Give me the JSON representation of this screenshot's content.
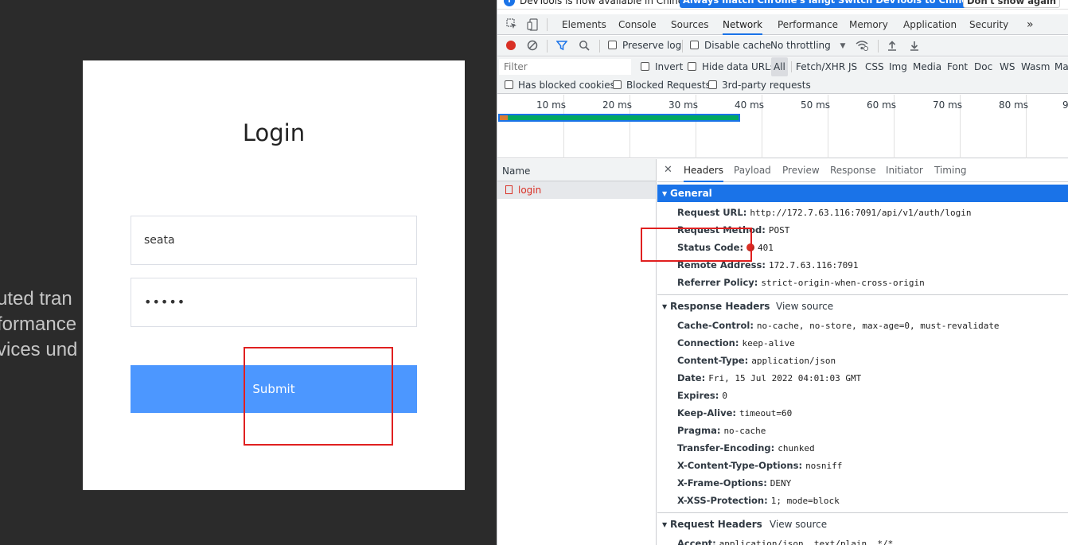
{
  "login_page": {
    "background_lines": [
      "uted tran",
      "formance",
      "vices und"
    ],
    "title": "Login",
    "username_value": "seata",
    "password_value": "•••••",
    "submit_label": "Submit"
  },
  "devtools": {
    "infobar": {
      "text": "DevTools is now available in Chinese!",
      "match_button": "Always match Chrome's language",
      "switch_button": "Switch DevTools to Chinese",
      "dont_show_button": "Don't show again"
    },
    "tabs": [
      "Elements",
      "Console",
      "Sources",
      "Network",
      "Performance",
      "Memory",
      "Application",
      "Security"
    ],
    "active_tab": "Network",
    "more_tabs": "»",
    "toolbar": {
      "preserve_log": "Preserve log",
      "disable_cache": "Disable cache",
      "throttling": "No throttling"
    },
    "filter": {
      "placeholder": "Filter",
      "invert": "Invert",
      "hide_data_urls": "Hide data URLs",
      "types": [
        "All",
        "Fetch/XHR",
        "JS",
        "CSS",
        "Img",
        "Media",
        "Font",
        "Doc",
        "WS",
        "Wasm",
        "Ma"
      ],
      "blocked_cookies": "Has blocked cookies",
      "blocked_requests": "Blocked Requests",
      "third_party": "3rd-party requests"
    },
    "timeline_labels": [
      "10 ms",
      "20 ms",
      "30 ms",
      "40 ms",
      "50 ms",
      "60 ms",
      "70 ms",
      "80 ms",
      "9"
    ],
    "request_list": {
      "header": "Name",
      "requests": [
        {
          "name": "login",
          "status": "error"
        }
      ]
    },
    "detail_tabs": [
      "Headers",
      "Payload",
      "Preview",
      "Response",
      "Initiator",
      "Timing"
    ],
    "active_detail_tab": "Headers",
    "general": {
      "title": "General",
      "rows": [
        {
          "name": "Request URL:",
          "value": "http://172.7.63.116:7091/api/v1/auth/login"
        },
        {
          "name": "Request Method:",
          "value": "POST"
        },
        {
          "name": "Status Code:",
          "value": "401"
        },
        {
          "name": "Remote Address:",
          "value": "172.7.63.116:7091"
        },
        {
          "name": "Referrer Policy:",
          "value": "strict-origin-when-cross-origin"
        }
      ]
    },
    "response_headers": {
      "title": "Response Headers",
      "view_source": "View source",
      "rows": [
        {
          "name": "Cache-Control:",
          "value": "no-cache, no-store, max-age=0, must-revalidate"
        },
        {
          "name": "Connection:",
          "value": "keep-alive"
        },
        {
          "name": "Content-Type:",
          "value": "application/json"
        },
        {
          "name": "Date:",
          "value": "Fri, 15 Jul 2022 04:01:03 GMT"
        },
        {
          "name": "Expires:",
          "value": "0"
        },
        {
          "name": "Keep-Alive:",
          "value": "timeout=60"
        },
        {
          "name": "Pragma:",
          "value": "no-cache"
        },
        {
          "name": "Transfer-Encoding:",
          "value": "chunked"
        },
        {
          "name": "X-Content-Type-Options:",
          "value": "nosniff"
        },
        {
          "name": "X-Frame-Options:",
          "value": "DENY"
        },
        {
          "name": "X-XSS-Protection:",
          "value": "1; mode=block"
        }
      ]
    },
    "request_headers": {
      "title": "Request Headers",
      "view_source": "View source",
      "rows": [
        {
          "name": "Accept:",
          "value": "application/json, text/plain, */*"
        }
      ]
    }
  }
}
